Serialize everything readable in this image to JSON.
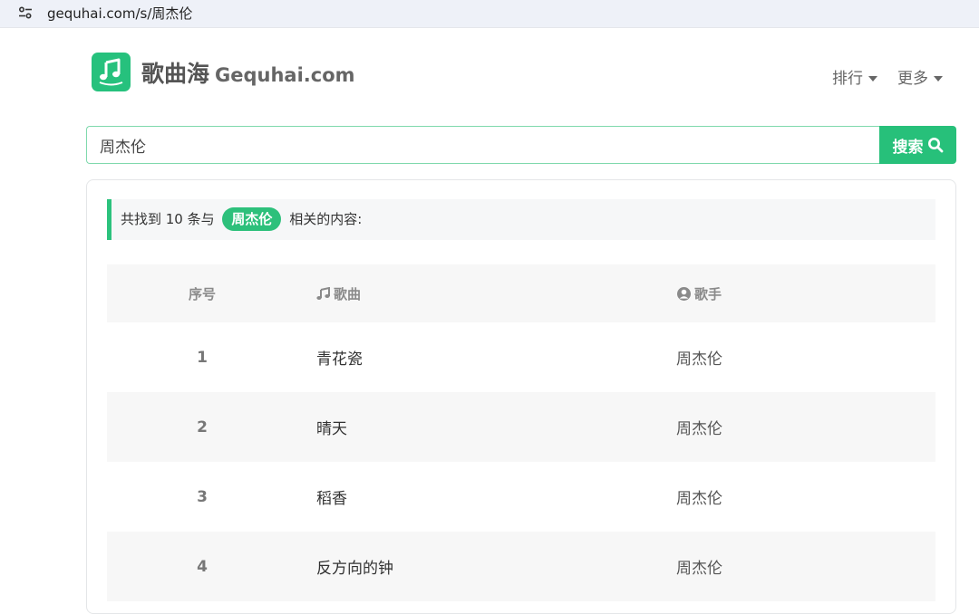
{
  "browser": {
    "url": "gequhai.com/s/周杰伦",
    "site_info_icon": "tune-icon"
  },
  "header": {
    "logo_icon": "music-note-icon",
    "brand_cn": "歌曲海",
    "brand_en": "Gequhai.com",
    "nav": [
      {
        "label": "排行",
        "icon": "caret-down-icon"
      },
      {
        "label": "更多",
        "icon": "caret-down-icon"
      }
    ]
  },
  "search": {
    "value": "周杰伦",
    "button_label": "搜索",
    "button_icon": "search-icon"
  },
  "results": {
    "prefix": "共找到 10 条与",
    "keyword": "周杰伦",
    "suffix": "相关的内容:",
    "columns": {
      "index": "序号",
      "song": "歌曲",
      "song_icon": "music-note-icon",
      "artist": "歌手",
      "artist_icon": "user-circle-icon"
    },
    "rows": [
      {
        "index": "1",
        "song": "青花瓷",
        "artist": "周杰伦"
      },
      {
        "index": "2",
        "song": "晴天",
        "artist": "周杰伦"
      },
      {
        "index": "3",
        "song": "稻香",
        "artist": "周杰伦"
      },
      {
        "index": "4",
        "song": "反方向的钟",
        "artist": "周杰伦"
      }
    ]
  },
  "colors": {
    "accent": "#27c07a",
    "row_alt": "#f7f7f7"
  }
}
